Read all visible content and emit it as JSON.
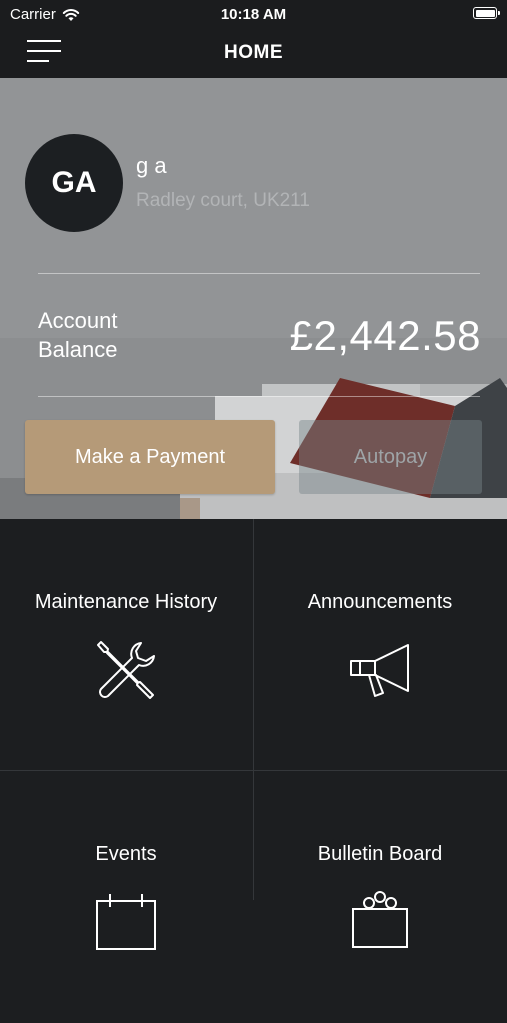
{
  "status_bar": {
    "carrier": "Carrier",
    "time": "10:18 AM"
  },
  "nav": {
    "title": "HOME"
  },
  "profile": {
    "initials": "GA",
    "name": "g a",
    "address": "Radley court, UK211"
  },
  "balance": {
    "label": "Account Balance",
    "amount": "£2,442.58"
  },
  "actions": {
    "make_payment": "Make a Payment",
    "autopay": "Autopay"
  },
  "tiles": [
    {
      "label": "Maintenance History",
      "icon": "wrench-screwdriver-icon"
    },
    {
      "label": "Announcements",
      "icon": "megaphone-icon"
    },
    {
      "label": "Events",
      "icon": "calendar-icon"
    },
    {
      "label": "Bulletin Board",
      "icon": "bulletin-board-icon"
    }
  ],
  "colors": {
    "accent": "#b59a78",
    "background": "#1c1e20",
    "navbar": "#1b1c1e"
  }
}
